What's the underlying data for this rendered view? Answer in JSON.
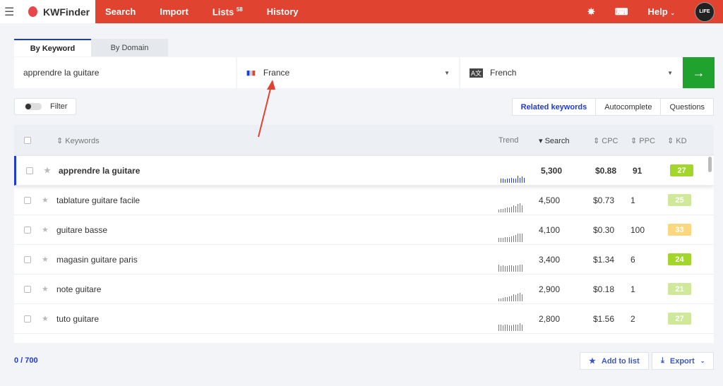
{
  "header": {
    "app_name": "KWFinder",
    "nav": [
      "Search",
      "Import",
      "Lists",
      "History"
    ],
    "lists_count": "58",
    "help": "Help",
    "avatar_text": "LIFE"
  },
  "tabs": [
    "By Keyword",
    "By Domain"
  ],
  "search": {
    "keyword": "apprendre la guitare",
    "location": "France",
    "language": "French",
    "go": "→"
  },
  "filter": "Filter",
  "views": [
    "Related keywords",
    "Autocomplete",
    "Questions"
  ],
  "columns": {
    "keywords": "Keywords",
    "trend": "Trend",
    "search": "Search",
    "cpc": "CPC",
    "ppc": "PPC",
    "kd": "KD"
  },
  "rows": [
    {
      "keyword": "apprendre la guitare",
      "search": "5,300",
      "cpc": "$0.88",
      "ppc": "91",
      "kd": "27",
      "kd_color": "#a3d62a",
      "trend": [
        6,
        6,
        5,
        6,
        6,
        7,
        6,
        6,
        10,
        7,
        9,
        7
      ]
    },
    {
      "keyword": "tablature guitare facile",
      "search": "4,500",
      "cpc": "$0.73",
      "ppc": "1",
      "kd": "25",
      "kd_color": "#cfe89a",
      "trend": [
        4,
        5,
        5,
        6,
        7,
        7,
        8,
        10,
        9,
        12,
        13,
        10
      ]
    },
    {
      "keyword": "guitare basse",
      "search": "4,100",
      "cpc": "$0.30",
      "ppc": "100",
      "kd": "33",
      "kd_color": "#fcd77f",
      "trend": [
        6,
        6,
        6,
        7,
        7,
        7,
        8,
        9,
        10,
        12,
        12,
        12
      ]
    },
    {
      "keyword": "magasin guitare paris",
      "search": "3,400",
      "cpc": "$1.34",
      "ppc": "6",
      "kd": "24",
      "kd_color": "#a3d62a",
      "trend": [
        10,
        8,
        9,
        8,
        8,
        9,
        9,
        8,
        9,
        9,
        10,
        10
      ]
    },
    {
      "keyword": "note guitare",
      "search": "2,900",
      "cpc": "$0.18",
      "ppc": "1",
      "kd": "21",
      "kd_color": "#cfe89a",
      "trend": [
        4,
        4,
        5,
        6,
        6,
        7,
        8,
        10,
        9,
        11,
        12,
        10
      ]
    },
    {
      "keyword": "tuto guitare",
      "search": "2,800",
      "cpc": "$1.56",
      "ppc": "2",
      "kd": "27",
      "kd_color": "#cfe89a",
      "trend": [
        9,
        9,
        8,
        9,
        9,
        8,
        8,
        9,
        9,
        9,
        11,
        9
      ]
    }
  ],
  "footer": {
    "count": "0 / 700",
    "add_to_list": "Add to list",
    "export": "Export"
  },
  "colors": {
    "brand": "#e0432f",
    "accent": "#1f3ad6",
    "go": "#1fa32e"
  }
}
